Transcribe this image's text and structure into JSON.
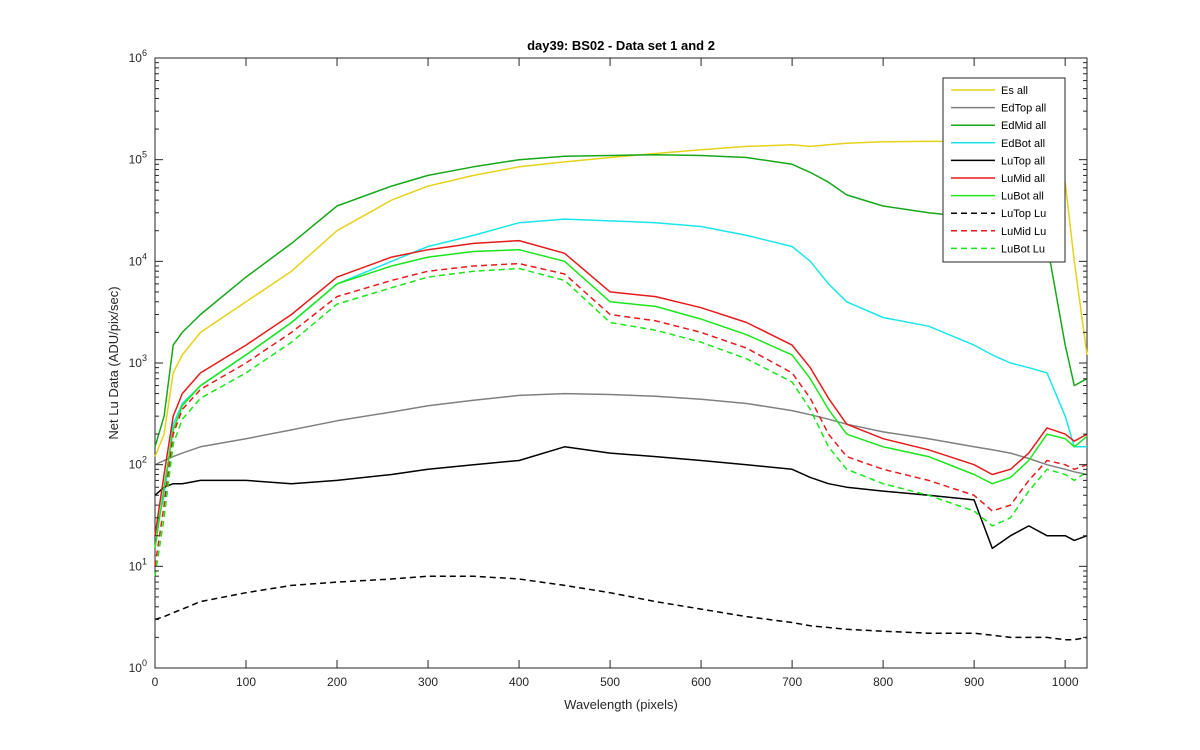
{
  "chart_data": {
    "type": "line",
    "title": "day39: BS02 - Data set 1 and 2",
    "xlabel": "Wavelength (pixels)",
    "ylabel": "Net Lu Data (ADU/pix/sec)",
    "xlim": [
      0,
      1024
    ],
    "ylim": [
      1,
      1000000
    ],
    "yscale": "log",
    "grid": false,
    "legend_position": "top-right",
    "x_ticks": [
      "0",
      "100",
      "200",
      "300",
      "400",
      "500",
      "600",
      "700",
      "800",
      "900",
      "1000"
    ],
    "y_ticks": [
      {
        "base": "10",
        "exp": "0"
      },
      {
        "base": "10",
        "exp": "1"
      },
      {
        "base": "10",
        "exp": "2"
      },
      {
        "base": "10",
        "exp": "3"
      },
      {
        "base": "10",
        "exp": "4"
      },
      {
        "base": "10",
        "exp": "5"
      },
      {
        "base": "10",
        "exp": "6"
      }
    ],
    "x": [
      0,
      10,
      20,
      30,
      50,
      100,
      150,
      200,
      260,
      300,
      350,
      400,
      450,
      500,
      550,
      600,
      650,
      700,
      720,
      740,
      760,
      800,
      850,
      900,
      920,
      940,
      960,
      980,
      1000,
      1010,
      1024
    ],
    "series": [
      {
        "name": "Es  all",
        "color": "#e6d21a",
        "dash": "solid",
        "values": [
          120,
          200,
          800,
          1200,
          2000,
          4000,
          8000,
          20000,
          40000,
          55000,
          70000,
          85000,
          95000,
          105000,
          115000,
          125000,
          135000,
          140000,
          135000,
          140000,
          145000,
          150000,
          152000,
          150000,
          150000,
          152000,
          155000,
          150000,
          60000,
          10000,
          1200
        ]
      },
      {
        "name": "EdTop  all",
        "color": "#808080",
        "dash": "solid",
        "values": [
          100,
          110,
          120,
          130,
          150,
          180,
          220,
          270,
          330,
          380,
          430,
          480,
          500,
          490,
          470,
          440,
          400,
          340,
          310,
          280,
          250,
          210,
          180,
          150,
          140,
          130,
          115,
          100,
          90,
          85,
          80
        ]
      },
      {
        "name": "EdMid  all",
        "color": "#16a81a",
        "dash": "solid",
        "values": [
          150,
          300,
          1500,
          2000,
          3000,
          7000,
          15000,
          35000,
          55000,
          70000,
          85000,
          100000,
          108000,
          110000,
          112000,
          110000,
          105000,
          90000,
          75000,
          60000,
          45000,
          35000,
          30000,
          27000,
          26000,
          25000,
          22000,
          15000,
          1500,
          600,
          700
        ]
      },
      {
        "name": "EdBot  all",
        "color": "#1ae6ea",
        "dash": "solid",
        "values": [
          20,
          50,
          250,
          400,
          600,
          1200,
          2500,
          6000,
          10000,
          14000,
          18000,
          24000,
          26000,
          25000,
          24000,
          22000,
          18000,
          14000,
          10000,
          6000,
          4000,
          2800,
          2300,
          1500,
          1200,
          1000,
          900,
          800,
          300,
          150,
          150
        ]
      },
      {
        "name": "LuTop  all",
        "color": "#000000",
        "dash": "solid",
        "values": [
          50,
          60,
          65,
          65,
          70,
          70,
          65,
          70,
          80,
          90,
          100,
          110,
          150,
          130,
          120,
          110,
          100,
          90,
          75,
          65,
          60,
          55,
          50,
          45,
          15,
          20,
          25,
          20,
          20,
          18,
          20
        ]
      },
      {
        "name": "LuMid  all",
        "color": "#e61a1a",
        "dash": "solid",
        "values": [
          20,
          80,
          300,
          500,
          800,
          1500,
          3000,
          7000,
          11000,
          13000,
          15000,
          16000,
          12000,
          5000,
          4500,
          3500,
          2500,
          1500,
          900,
          450,
          250,
          180,
          140,
          100,
          80,
          90,
          130,
          230,
          200,
          170,
          200
        ]
      },
      {
        "name": "LuBot  all",
        "color": "#1ae61a",
        "dash": "solid",
        "values": [
          15,
          60,
          220,
          380,
          600,
          1200,
          2500,
          6000,
          9000,
          11000,
          12500,
          13000,
          10000,
          4000,
          3600,
          2700,
          1900,
          1200,
          700,
          350,
          200,
          150,
          120,
          80,
          65,
          75,
          110,
          200,
          180,
          150,
          190
        ]
      },
      {
        "name": "LuTop  Lu",
        "color": "#000000",
        "dash": "dashed",
        "values": [
          3,
          3.2,
          3.5,
          3.8,
          4.5,
          5.5,
          6.5,
          7,
          7.5,
          8,
          8,
          7.5,
          6.5,
          5.5,
          4.5,
          3.8,
          3.2,
          2.8,
          2.6,
          2.5,
          2.4,
          2.3,
          2.2,
          2.2,
          2.1,
          2.0,
          2.0,
          2.0,
          1.9,
          1.9,
          2.0
        ]
      },
      {
        "name": "LuMid  Lu",
        "color": "#e61a1a",
        "dash": "dashed",
        "values": [
          10,
          40,
          200,
          350,
          550,
          1000,
          2000,
          4500,
          6500,
          8000,
          9000,
          9500,
          7500,
          3000,
          2600,
          2000,
          1400,
          800,
          450,
          200,
          120,
          90,
          70,
          50,
          35,
          40,
          70,
          110,
          100,
          90,
          100
        ]
      },
      {
        "name": "LuBot  Lu",
        "color": "#1ae61a",
        "dash": "dashed",
        "values": [
          8,
          30,
          160,
          280,
          450,
          800,
          1600,
          3800,
          5500,
          7000,
          8000,
          8500,
          6500,
          2500,
          2100,
          1600,
          1100,
          650,
          350,
          150,
          90,
          65,
          50,
          35,
          25,
          30,
          55,
          90,
          80,
          70,
          85
        ]
      }
    ]
  }
}
